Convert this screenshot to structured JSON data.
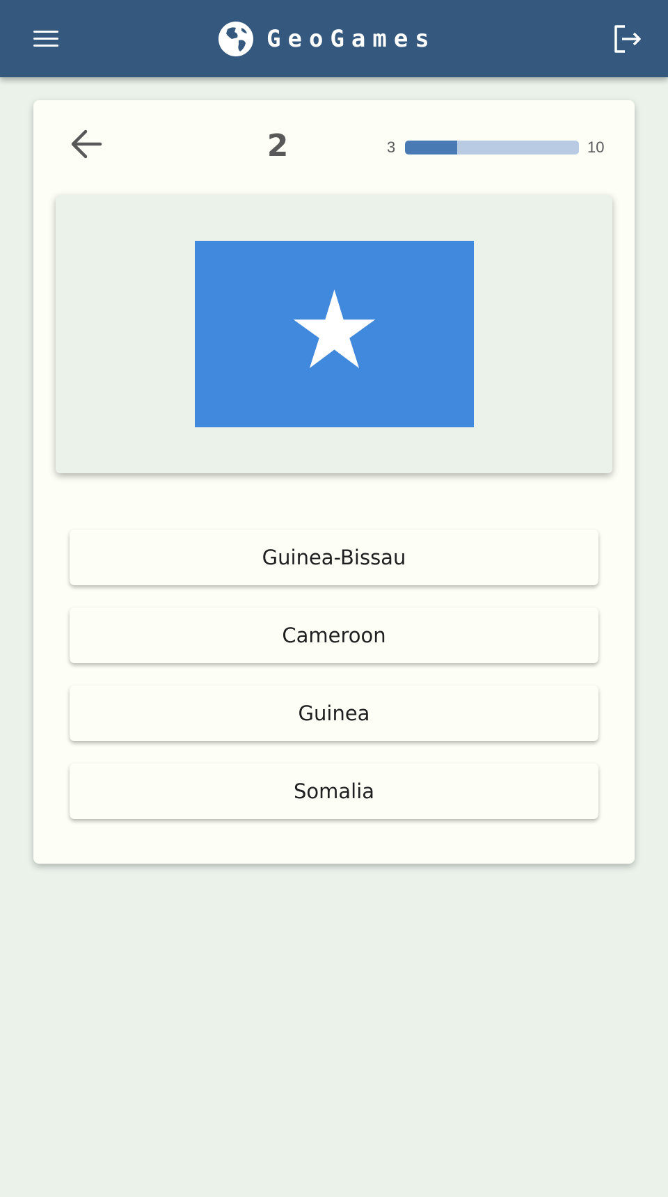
{
  "header": {
    "brand": "GeoGames",
    "menu_icon": "hamburger-menu-icon",
    "logo_icon": "globe-icon",
    "logout_icon": "logout-icon",
    "bg_color": "#34587e"
  },
  "quiz": {
    "back_icon": "arrow-left-icon",
    "question_number": "2",
    "progress": {
      "current_label": "3",
      "total_label": "10",
      "fraction": 0.3
    },
    "flag": {
      "country_shown": "Somalia",
      "field_color": "#4189dd",
      "star_color": "#ffffff"
    },
    "answers": [
      {
        "label": "Guinea-Bissau"
      },
      {
        "label": "Cameroon"
      },
      {
        "label": "Guinea"
      },
      {
        "label": "Somalia"
      }
    ]
  }
}
